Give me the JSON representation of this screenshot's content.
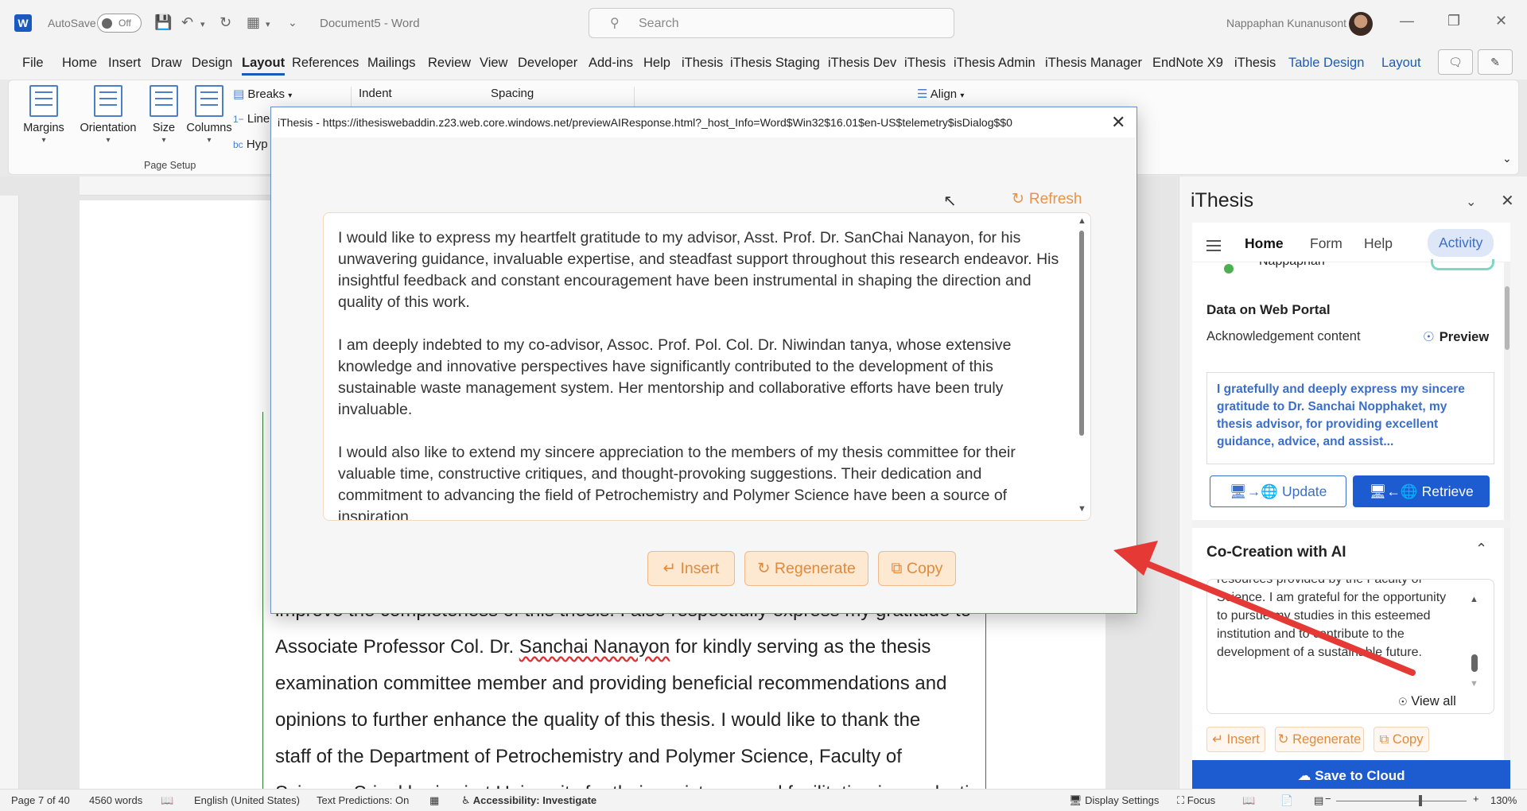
{
  "titlebar": {
    "autosave_label": "AutoSave",
    "autosave_state": "Off",
    "doc_title": "Document5  -  Word",
    "search_placeholder": "Search",
    "user_name": "Nappaphan Kunanusont"
  },
  "menu": [
    "File",
    "Home",
    "Insert",
    "Draw",
    "Design",
    "Layout",
    "References",
    "Mailings",
    "Review",
    "View",
    "Developer",
    "Add-ins",
    "Help",
    "iThesis",
    "iThesis Staging",
    "iThesis Dev",
    "iThesis",
    "iThesis Admin",
    "iThesis Manager",
    "EndNote X9",
    "iThesis",
    "Table Design",
    "Layout"
  ],
  "ribbon": {
    "margins": "Margins",
    "orientation": "Orientation",
    "size": "Size",
    "columns": "Columns",
    "breaks": "Breaks",
    "line": "Line",
    "hyp": "Hyp",
    "group_page_setup": "Page Setup",
    "indent": "Indent",
    "spacing": "Spacing",
    "align": "Align"
  },
  "document": {
    "lines": [
      "improve the completeness of this thesis. I also respectfully express my gratitude to",
      "Associate Professor Col. Dr. ",
      "examination committee member and providing beneficial recommendations and",
      "opinions to further enhance the quality of this thesis. I would like to thank the",
      "staff of the Department of Petrochemistry and Polymer Science, Faculty of",
      "Science, Srinakharinwirot University for their assistance and facilitation in conducting"
    ],
    "line2_name": "Sanchai Nanayon",
    "line2_rest": " for kindly serving as the thesis"
  },
  "dialog": {
    "title": "iThesis - https://ithesiswebaddin.z23.web.core.windows.net/previewAIResponse.html?_host_Info=Word$Win32$16.01$en-US$telemetry$isDialog$$0",
    "refresh": "Refresh",
    "paragraphs": [
      "I would like to express my heartfelt gratitude to my advisor, Asst. Prof. Dr. SanChai Nanayon, for his unwavering guidance, invaluable expertise, and steadfast support throughout this research endeavor. His insightful feedback and constant encouragement have been instrumental in shaping the direction and quality of this work.",
      "I am deeply indebted to my co-advisor, Assoc. Prof. Pol. Col. Dr. Niwindan tanya, whose extensive knowledge and innovative perspectives have significantly contributed to the development of this sustainable waste management system. Her mentorship and collaborative efforts have been truly invaluable.",
      "I would also like to extend my sincere appreciation to the members of my thesis committee for their valuable time, constructive critiques, and thought-provoking suggestions. Their dedication and commitment to advancing the field of Petrochemistry and Polymer Science have been a source of inspiration."
    ],
    "insert": "Insert",
    "regenerate": "Regenerate",
    "copy": "Copy"
  },
  "pane": {
    "title": "iThesis",
    "tabs": {
      "home": "Home",
      "form": "Form",
      "help": "Help",
      "activity": "Activity"
    },
    "user_partial": "Nappaphan",
    "data_section": "Data on Web Portal",
    "ack_label": "Acknowledgement content",
    "preview": "Preview",
    "ack_text": "I gratefully and deeply express my sincere gratitude to Dr. Sanchai Nopphaket, my thesis advisor, for providing excellent guidance, advice, and assist...",
    "update": "Update",
    "retrieve": "Retrieve",
    "cocreation": "Co-Creation with AI",
    "ai_text": "resources provided by the Faculty of Science. I am grateful for the opportunity to pursue my studies in this esteemed institution and to contribute to the development of a sustainable future.",
    "view_all": "View all",
    "insert": "Insert",
    "regenerate": "Regenerate",
    "copy": "Copy",
    "save_cloud": "Save to Cloud"
  },
  "status": {
    "page": "Page 7 of 40",
    "words": "4560 words",
    "language": "English (United States)",
    "predictions": "Text Predictions: On",
    "accessibility": "Accessibility: Investigate",
    "display": "Display Settings",
    "focus": "Focus",
    "zoom": "130%"
  },
  "colors": {
    "accent": "#185abd",
    "orange": "#e08a3a",
    "pane_blue": "#1d5bd0",
    "arrow": "#e53935"
  }
}
